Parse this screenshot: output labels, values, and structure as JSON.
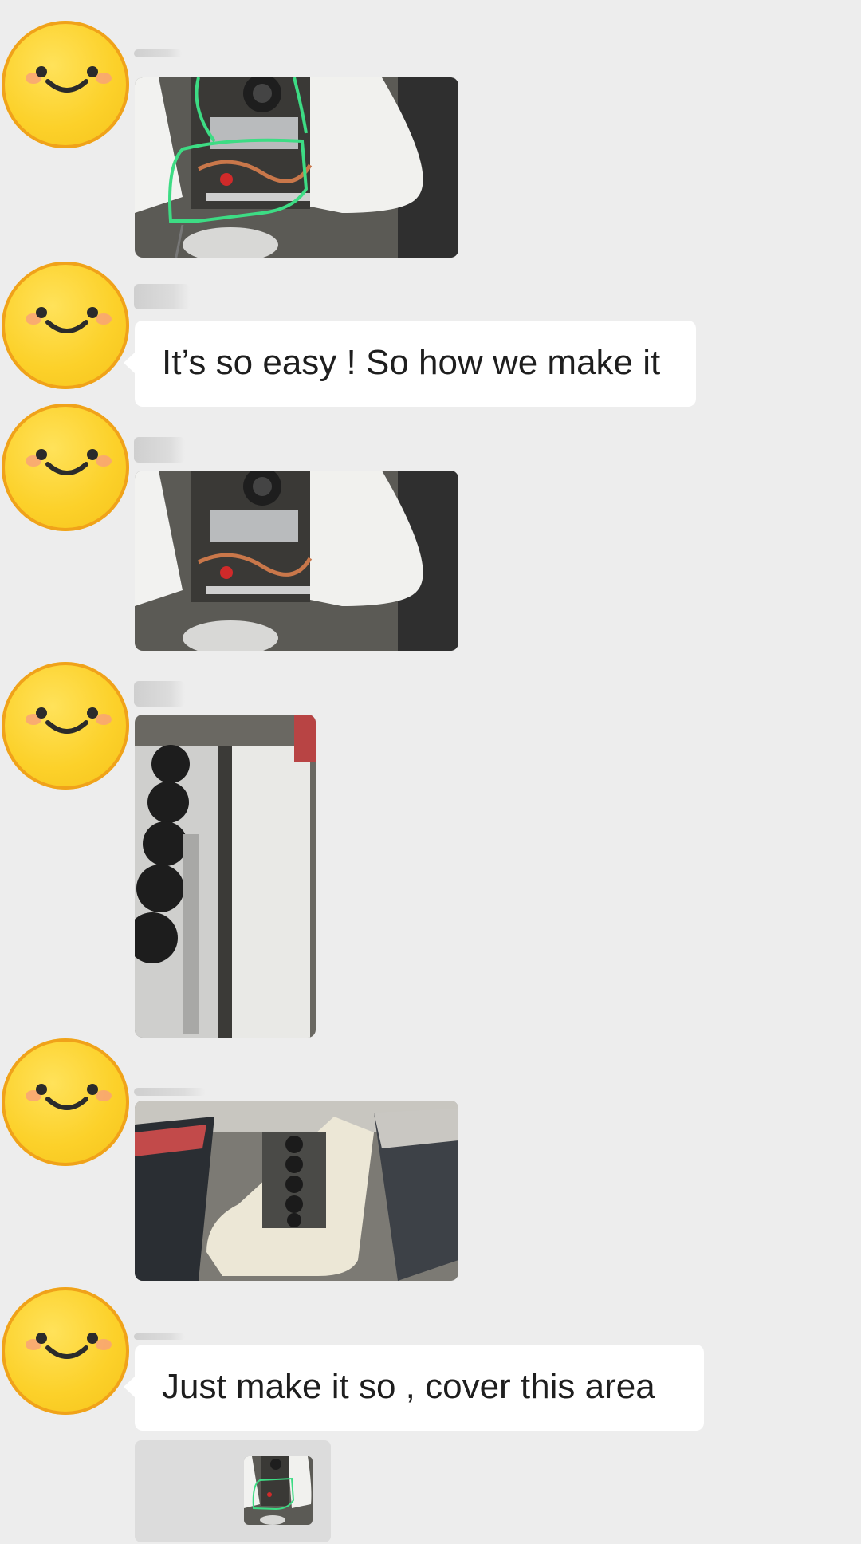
{
  "messages": [
    {
      "type": "image",
      "image_icon": "ac-unit-annotated-photo"
    },
    {
      "type": "text",
      "text": "It’s so easy ! So how we make it"
    },
    {
      "type": "image",
      "image_icon": "ac-unit-open-photo"
    },
    {
      "type": "image",
      "image_icon": "ac-unit-side-photo"
    },
    {
      "type": "image",
      "image_icon": "ac-unit-bus-roof-photo"
    },
    {
      "type": "text",
      "text": "Just make it so , cover this area"
    },
    {
      "type": "image",
      "image_icon": "ac-unit-thumbnail-photo"
    }
  ],
  "colors": {
    "background": "#ededed",
    "bubble": "#ffffff",
    "text": "#1e1e1e",
    "avatar": "#fcd12a",
    "annotation": "#3ddc84"
  }
}
